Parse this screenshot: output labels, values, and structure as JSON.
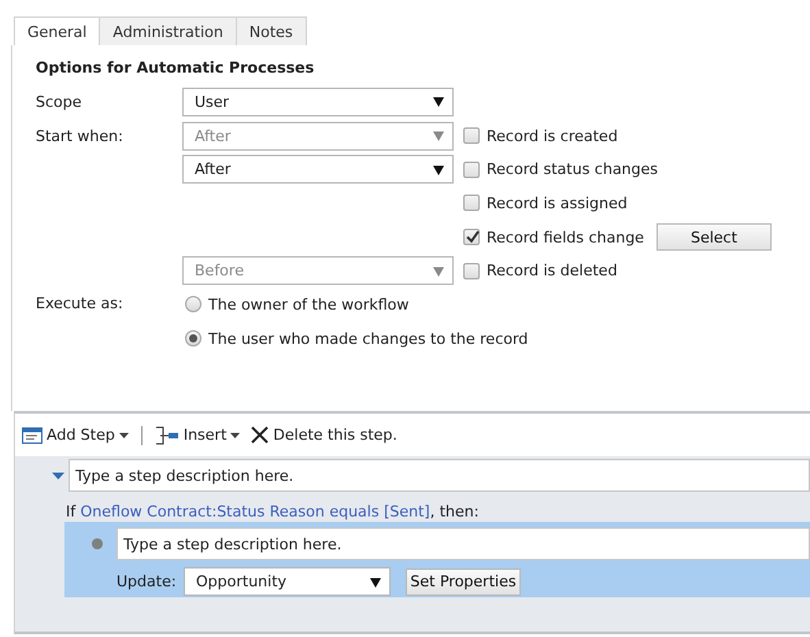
{
  "tabs": [
    {
      "label": "General",
      "selected": true
    },
    {
      "label": "Administration",
      "selected": false
    },
    {
      "label": "Notes",
      "selected": false
    }
  ],
  "options": {
    "heading": "Options for Automatic Processes",
    "scope": {
      "label": "Scope",
      "value": "User",
      "disabled": false
    },
    "start_when": {
      "label": "Start when:",
      "rows": [
        {
          "select": {
            "value": "After",
            "disabled": true
          },
          "checkbox": {
            "label": "Record is created",
            "checked": false
          }
        },
        {
          "select": {
            "value": "After",
            "disabled": false
          },
          "checkbox": {
            "label": "Record status changes",
            "checked": false
          }
        },
        {
          "checkbox": {
            "label": "Record is assigned",
            "checked": false
          }
        },
        {
          "checkbox": {
            "label": "Record fields change",
            "checked": true
          },
          "button": "Select"
        },
        {
          "select": {
            "value": "Before",
            "disabled": true
          },
          "checkbox": {
            "label": "Record is deleted",
            "checked": false
          }
        }
      ]
    },
    "execute_as": {
      "label": "Execute as:",
      "options": [
        {
          "label": "The owner of the workflow",
          "selected": false
        },
        {
          "label": "The user who made changes to the record",
          "selected": true
        }
      ]
    }
  },
  "toolbar": [
    {
      "kind": "add",
      "label": "Add Step"
    },
    {
      "kind": "insert",
      "label": "Insert"
    },
    {
      "kind": "delete",
      "label": "Delete this step."
    }
  ],
  "steps": {
    "description": "Type a step description here.",
    "condition": {
      "prefix": "If ",
      "link": "Oneflow Contract:Status Reason equals [Sent]",
      "suffix": ", then:"
    },
    "action": {
      "description": "Type a step description here.",
      "label": "Update:",
      "entity": "Opportunity",
      "button": "Set Properties"
    }
  }
}
